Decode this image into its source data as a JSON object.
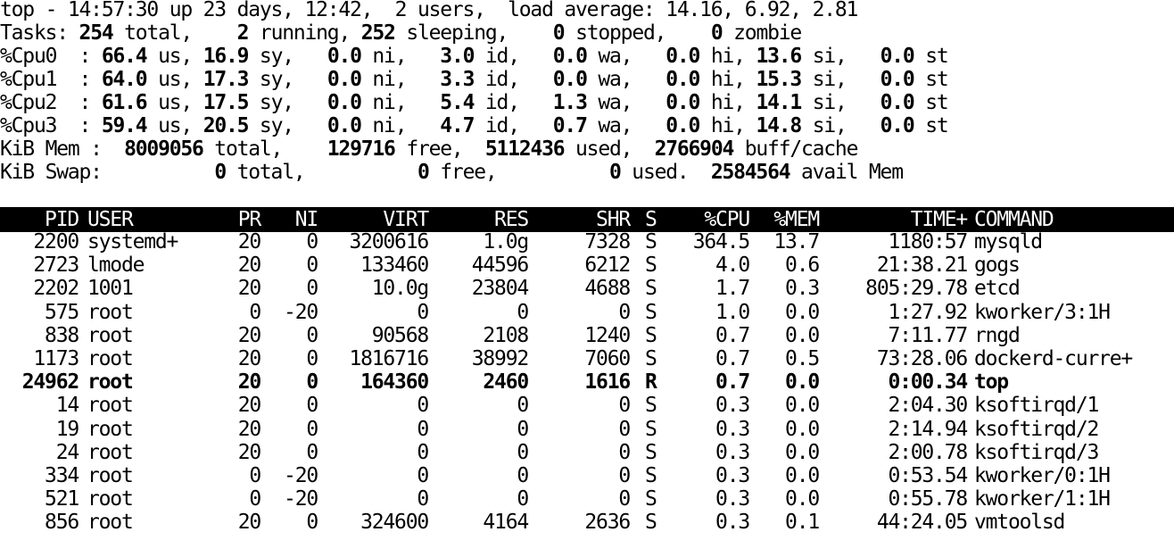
{
  "summary": {
    "line1": "top - 14:57:30 up 23 days, 12:42,  2 users,  load average: 14.16, 6.92, 2.81",
    "tasks": {
      "label": "Tasks:",
      "total": "254",
      "running": "2",
      "sleeping": "252",
      "stopped": "0",
      "zombie": "0"
    },
    "cpus": [
      {
        "name": "%Cpu0",
        "us": "66.4",
        "sy": "16.9",
        "ni": "0.0",
        "id": "3.0",
        "wa": "0.0",
        "hi": "0.0",
        "si": "13.6",
        "st": "0.0"
      },
      {
        "name": "%Cpu1",
        "us": "64.0",
        "sy": "17.3",
        "ni": "0.0",
        "id": "3.3",
        "wa": "0.0",
        "hi": "0.0",
        "si": "15.3",
        "st": "0.0"
      },
      {
        "name": "%Cpu2",
        "us": "61.6",
        "sy": "17.5",
        "ni": "0.0",
        "id": "5.4",
        "wa": "1.3",
        "hi": "0.0",
        "si": "14.1",
        "st": "0.0"
      },
      {
        "name": "%Cpu3",
        "us": "59.4",
        "sy": "20.5",
        "ni": "0.0",
        "id": "4.7",
        "wa": "0.7",
        "hi": "0.0",
        "si": "14.8",
        "st": "0.0"
      }
    ],
    "mem": {
      "label": "KiB Mem :",
      "total": "8009056",
      "free": "129716",
      "used": "5112436",
      "buff": "2766904"
    },
    "swap": {
      "label": "KiB Swap:",
      "total": "0",
      "free": "0",
      "used": "0",
      "avail": "2584564"
    }
  },
  "columns": [
    "PID",
    "USER",
    "PR",
    "NI",
    "VIRT",
    "RES",
    "SHR",
    "S",
    "%CPU",
    "%MEM",
    "TIME+",
    "COMMAND"
  ],
  "processes": [
    {
      "pid": "2200",
      "user": "systemd+",
      "pr": "20",
      "ni": "0",
      "virt": "3200616",
      "res": "1.0g",
      "shr": "7328",
      "s": "S",
      "cpu": "364.5",
      "mem": "13.7",
      "time": "1180:57",
      "cmd": "mysqld"
    },
    {
      "pid": "2723",
      "user": "lmode",
      "pr": "20",
      "ni": "0",
      "virt": "133460",
      "res": "44596",
      "shr": "6212",
      "s": "S",
      "cpu": "4.0",
      "mem": "0.6",
      "time": "21:38.21",
      "cmd": "gogs"
    },
    {
      "pid": "2202",
      "user": "1001",
      "pr": "20",
      "ni": "0",
      "virt": "10.0g",
      "res": "23804",
      "shr": "4688",
      "s": "S",
      "cpu": "1.7",
      "mem": "0.3",
      "time": "805:29.78",
      "cmd": "etcd"
    },
    {
      "pid": "575",
      "user": "root",
      "pr": "0",
      "ni": "-20",
      "virt": "0",
      "res": "0",
      "shr": "0",
      "s": "S",
      "cpu": "1.0",
      "mem": "0.0",
      "time": "1:27.92",
      "cmd": "kworker/3:1H"
    },
    {
      "pid": "838",
      "user": "root",
      "pr": "20",
      "ni": "0",
      "virt": "90568",
      "res": "2108",
      "shr": "1240",
      "s": "S",
      "cpu": "0.7",
      "mem": "0.0",
      "time": "7:11.77",
      "cmd": "rngd"
    },
    {
      "pid": "1173",
      "user": "root",
      "pr": "20",
      "ni": "0",
      "virt": "1816716",
      "res": "38992",
      "shr": "7060",
      "s": "S",
      "cpu": "0.7",
      "mem": "0.5",
      "time": "73:28.06",
      "cmd": "dockerd-curre+"
    },
    {
      "pid": "24962",
      "user": "root",
      "pr": "20",
      "ni": "0",
      "virt": "164360",
      "res": "2460",
      "shr": "1616",
      "s": "R",
      "cpu": "0.7",
      "mem": "0.0",
      "time": "0:00.34",
      "cmd": "top",
      "bold": true
    },
    {
      "pid": "14",
      "user": "root",
      "pr": "20",
      "ni": "0",
      "virt": "0",
      "res": "0",
      "shr": "0",
      "s": "S",
      "cpu": "0.3",
      "mem": "0.0",
      "time": "2:04.30",
      "cmd": "ksoftirqd/1"
    },
    {
      "pid": "19",
      "user": "root",
      "pr": "20",
      "ni": "0",
      "virt": "0",
      "res": "0",
      "shr": "0",
      "s": "S",
      "cpu": "0.3",
      "mem": "0.0",
      "time": "2:14.94",
      "cmd": "ksoftirqd/2"
    },
    {
      "pid": "24",
      "user": "root",
      "pr": "20",
      "ni": "0",
      "virt": "0",
      "res": "0",
      "shr": "0",
      "s": "S",
      "cpu": "0.3",
      "mem": "0.0",
      "time": "2:00.78",
      "cmd": "ksoftirqd/3"
    },
    {
      "pid": "334",
      "user": "root",
      "pr": "0",
      "ni": "-20",
      "virt": "0",
      "res": "0",
      "shr": "0",
      "s": "S",
      "cpu": "0.3",
      "mem": "0.0",
      "time": "0:53.54",
      "cmd": "kworker/0:1H"
    },
    {
      "pid": "521",
      "user": "root",
      "pr": "0",
      "ni": "-20",
      "virt": "0",
      "res": "0",
      "shr": "0",
      "s": "S",
      "cpu": "0.3",
      "mem": "0.0",
      "time": "0:55.78",
      "cmd": "kworker/1:1H"
    },
    {
      "pid": "856",
      "user": "root",
      "pr": "20",
      "ni": "0",
      "virt": "324600",
      "res": "4164",
      "shr": "2636",
      "s": "S",
      "cpu": "0.3",
      "mem": "0.1",
      "time": "44:24.05",
      "cmd": "vmtoolsd"
    }
  ]
}
